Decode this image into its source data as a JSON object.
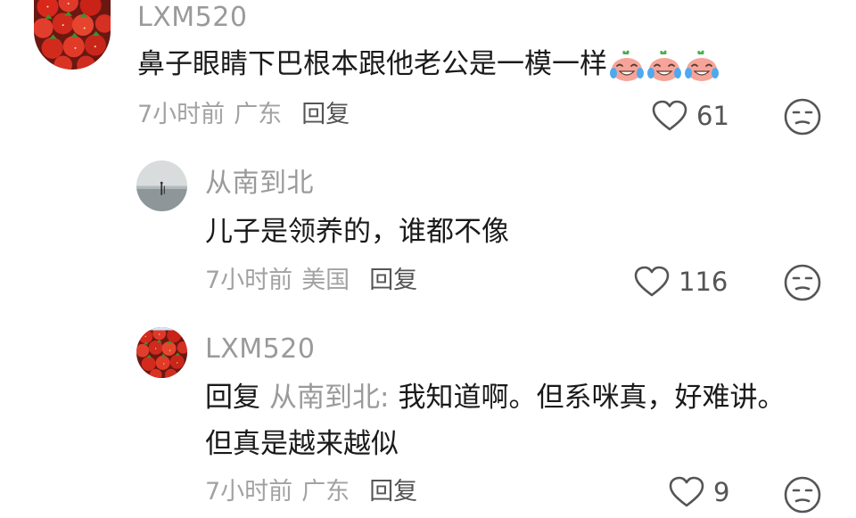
{
  "comments": [
    {
      "username": "LXM520",
      "text": "鼻子眼睛下巴根本跟他老公是一模一样",
      "emojis": [
        "crying-laughing",
        "crying-laughing",
        "crying-laughing"
      ],
      "time": "7小时前",
      "location": "广东",
      "reply_label": "回复",
      "likes": "61",
      "avatar_icon": "strawberries"
    },
    {
      "username": "从南到北",
      "text": "儿子是领养的，谁都不像",
      "time": "7小时前",
      "location": "美国",
      "reply_label": "回复",
      "likes": "116",
      "avatar_icon": "beach-scene"
    },
    {
      "username": "LXM520",
      "reply_prefix": "回复",
      "reply_to": "从南到北:",
      "text_line1": "我知道啊。但系咪真，好难讲。",
      "text_line2": "但真是越来越似",
      "time": "7小时前",
      "location": "广东",
      "reply_label": "回复",
      "likes": "9",
      "avatar_icon": "strawberries"
    }
  ],
  "colors": {
    "username": "#9a9a9a",
    "text": "#1a1a1a",
    "meta": "#a2a2a2",
    "icon": "#555555",
    "strawberry": "#d8281c",
    "sea": "#9aa3a6"
  }
}
